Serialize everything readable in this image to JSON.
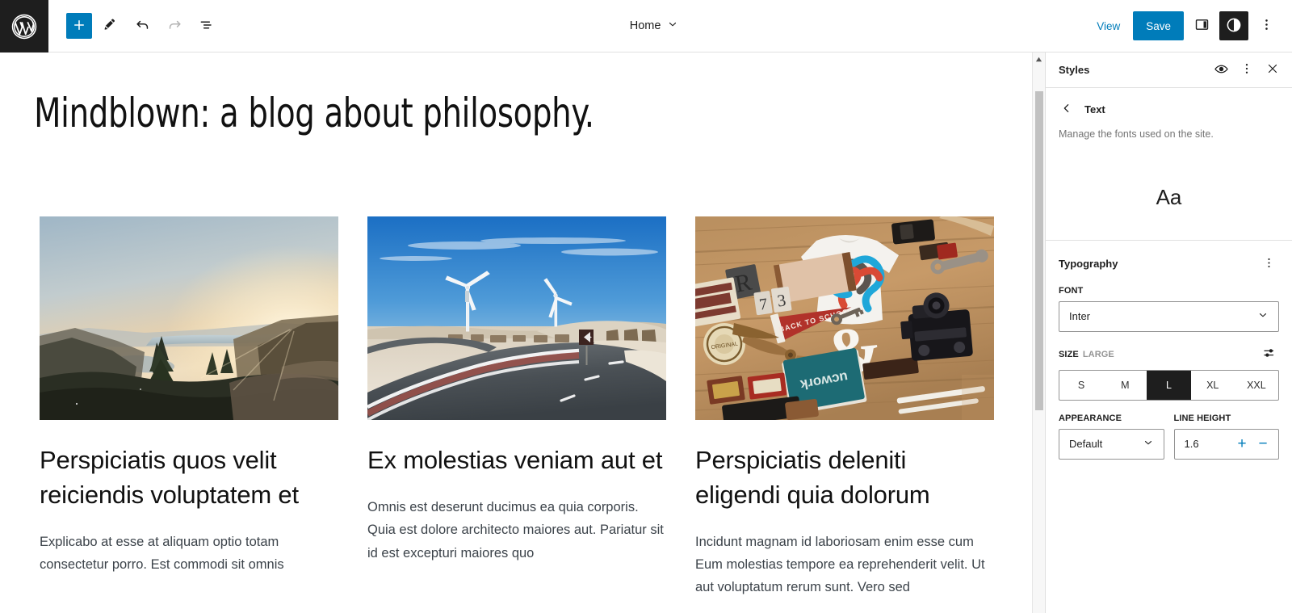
{
  "topbar": {
    "logo_icon": "wordpress-logo-icon",
    "tools": [
      {
        "name": "add-block-button",
        "icon": "plus-icon",
        "label": "+"
      },
      {
        "name": "edit-tool-button",
        "icon": "pencil-icon",
        "label": ""
      },
      {
        "name": "undo-button",
        "icon": "undo-arrow-icon",
        "label": ""
      },
      {
        "name": "redo-button",
        "icon": "redo-arrow-icon",
        "label": ""
      },
      {
        "name": "list-view-button",
        "icon": "list-view-icon",
        "label": ""
      }
    ],
    "document_title": "Home",
    "document_chevron_icon": "chevron-down-icon",
    "view_label": "View",
    "save_label": "Save",
    "sidebar_toggle_icon": "sidebar-panel-icon",
    "styles_toggle_icon": "contrast-circle-icon",
    "more_menu_icon": "three-dots-vertical-icon",
    "accent_color": "#007cba",
    "logo_bg": "#1e1e1e"
  },
  "canvas": {
    "site_title": "Mindblown: a blog about philosophy.",
    "posts": [
      {
        "image_name": "sunset-river-valley-photo",
        "title": "Perspiciatis quos velit reiciendis voluptatem et",
        "excerpt": "Explicabo at esse at aliquam optio totam consectetur porro. Est commodi sit omnis"
      },
      {
        "image_name": "wind-turbines-road-photo",
        "title": "Ex molestias veniam aut et",
        "excerpt": "Omnis est deserunt ducimus ea quia corporis. Quia est dolore architecto maiores aut. Pariatur sit id est excepturi maiores quo"
      },
      {
        "image_name": "desk-flatlay-design-objects-photo",
        "title": "Perspiciatis deleniti eligendi quia dolorum",
        "excerpt": "Incidunt magnam id laboriosam enim esse cum Eum molestias tempore ea reprehenderit velit. Ut aut voluptatum rerum sunt. Vero sed"
      }
    ]
  },
  "sidebar": {
    "header_title": "Styles",
    "header_icons": {
      "preview": "eye-icon",
      "more": "three-dots-vertical-icon",
      "close": "close-x-icon"
    },
    "back_icon": "chevron-left-icon",
    "nav_label": "Text",
    "description": "Manage the fonts used on the site.",
    "font_preview": "Aa",
    "typography": {
      "section_title": "Typography",
      "more_icon": "three-dots-vertical-icon",
      "font_label": "FONT",
      "font_value": "Inter",
      "font_chevron_icon": "chevron-down-icon",
      "size_label": "SIZE",
      "size_value_label": "LARGE",
      "size_settings_icon": "sliders-icon",
      "size_options": [
        "S",
        "M",
        "L",
        "XL",
        "XXL"
      ],
      "size_selected": "L",
      "appearance_label": "APPEARANCE",
      "appearance_value": "Default",
      "appearance_chevron_icon": "chevron-down-icon",
      "line_height_label": "LINE HEIGHT",
      "line_height_value": "1.6",
      "increment_label": "+",
      "decrement_label": "−"
    }
  },
  "scrollbar": {
    "up_arrow_icon": "scroll-up-arrow-icon"
  }
}
